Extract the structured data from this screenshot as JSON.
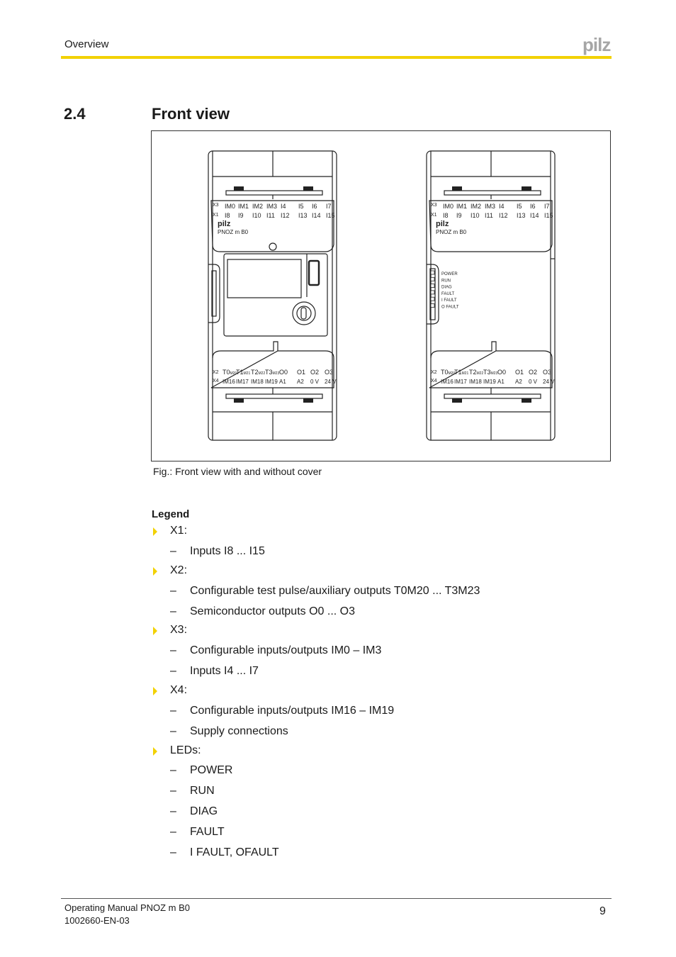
{
  "header": {
    "section_label": "Overview",
    "logo_text": "pilz",
    "accent_color": "#f2d100"
  },
  "section": {
    "number": "2.4",
    "title": "Front view"
  },
  "figure": {
    "caption": "Fig.: Front view with and without cover",
    "device": {
      "brand": "pilz",
      "model": "PNOZ m B0",
      "top_row_label": "X3",
      "top_row": [
        "IM0",
        "IM1",
        "IM2",
        "IM3",
        "I4",
        "I5",
        "I6",
        "I7"
      ],
      "second_row_label": "X1",
      "second_row": [
        "I8",
        "I9",
        "I10",
        "I11",
        "I12",
        "I13",
        "I14",
        "I15"
      ],
      "bottom_row_label": "X2",
      "bottom_row": [
        {
          "main": "T0",
          "sub": "M20"
        },
        {
          "main": "T1",
          "sub": "M21"
        },
        {
          "main": "T2",
          "sub": "M22"
        },
        {
          "main": "T3",
          "sub": "M23"
        },
        {
          "main": "O0",
          "sub": ""
        },
        {
          "main": "O1",
          "sub": ""
        },
        {
          "main": "O2",
          "sub": ""
        },
        {
          "main": "O3",
          "sub": ""
        }
      ],
      "last_row_label": "X4",
      "last_row": [
        "IM16",
        "IM17",
        "IM18",
        "IM19",
        "A1",
        "A2",
        "0 V",
        "24 V"
      ],
      "leds": [
        "POWER",
        "RUN",
        "DIAG",
        "FAULT",
        "I FAULT",
        "O FAULT"
      ]
    }
  },
  "legend": {
    "heading": "Legend",
    "groups": [
      {
        "label": "X1:",
        "items": [
          "Inputs I8 ... I15"
        ]
      },
      {
        "label": "X2:",
        "items": [
          "Configurable test pulse/auxiliary outputs T0M20 ... T3M23",
          "Semiconductor outputs O0 ... O3"
        ]
      },
      {
        "label": "X3:",
        "items": [
          "Configurable inputs/outputs IM0 – IM3",
          "Inputs I4 ... I7"
        ]
      },
      {
        "label": "X4:",
        "items": [
          "Configurable inputs/outputs IM16 – IM19",
          "Supply connections"
        ]
      },
      {
        "label": "LEDs:",
        "items": [
          "POWER",
          "RUN",
          "DIAG",
          "FAULT",
          "I FAULT, OFAULT"
        ]
      }
    ],
    "dash": "–"
  },
  "footer": {
    "manual_title": "Operating Manual PNOZ m B0",
    "doc_number": "1002660-EN-03",
    "page_number": "9"
  }
}
